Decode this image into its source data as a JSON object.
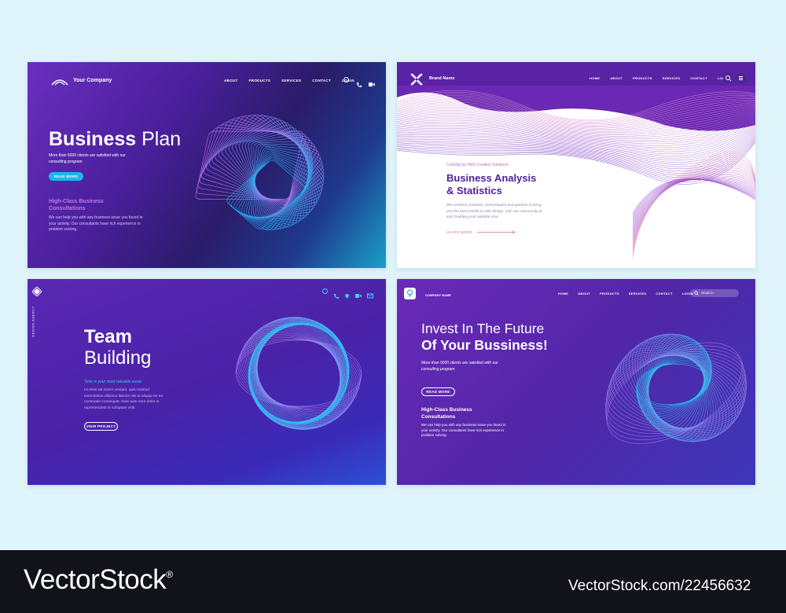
{
  "card1": {
    "company": "Your Company",
    "nav": [
      "ABOUT",
      "PRODUCTS",
      "SERVICES",
      "CONTACT",
      "LOGIN"
    ],
    "title_bold": "Business",
    "title_light": "Plan",
    "intro": "More than 5000 clients are satisfied with our consulting program",
    "button": "READ MORE",
    "subheading": "High-Class Business Consultations",
    "body": "We can help you with any business issue you faced in your activity. Our consultants have rich experience in problem solving."
  },
  "card2": {
    "brand": "Brand Name",
    "nav": [
      "HOME",
      "ABOUT",
      "PRODUCTS",
      "SERVICES",
      "CONTACT",
      "LOGIN"
    ],
    "eyebrow": "Coming Up With Creative Solutions",
    "title_line1": "Business Analysis",
    "title_line2": "& Statistics",
    "body": "We combine creativity, technologies and passion to bring you the best results in web design. Join our community to start building your website now",
    "link": "LEARN MORE"
  },
  "card3": {
    "vertical_label": "DESIGN AGENCY",
    "title_line1": "Team",
    "title_line2": "Building",
    "tagline": "Time is your most valuable asset",
    "body": "Ut enim ad minim veniam, quis nostrud exercitation ullamco laboris nisi ut aliquip ex ea commodo consequat. Duis aute irure dolor in reprehenderit in voluptate velit.",
    "button": "VIEW PROJECT"
  },
  "card4": {
    "company": "COMPANY NAME",
    "nav": [
      "HOME",
      "ABOUT",
      "PRODUCTS",
      "SERVICES",
      "CONTACT",
      "LOGIN"
    ],
    "search_placeholder": "SEARCH",
    "title_line1": "Invest In The Future",
    "title_line2": "Of Your Bussiness!",
    "intro": "More than 5000 clients are satisfied with our consulting program",
    "button": "READ MORE",
    "subheading": "High-Class Business Consultations",
    "body": "We can help you with any business issue you faced in your activity. Our consultants have rich experience in problem solving."
  },
  "footer": {
    "brand": "VectorStock",
    "registered": "®",
    "stock_id": "VectorStock.com/22456632"
  },
  "colors": {
    "page_bg": "#dff4fa",
    "accent_cyan": "#1cb6f0",
    "purple": "#5a2da8",
    "footer_bg": "#11121a"
  }
}
